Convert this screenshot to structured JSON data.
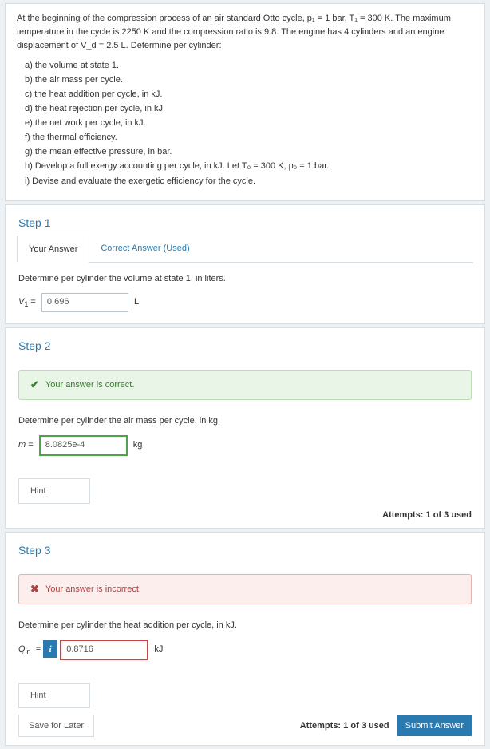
{
  "problem": {
    "stem": "At the beginning of the compression process of an air standard Otto cycle, p₁ = 1 bar, T₁ = 300 K. The maximum temperature in the cycle is 2250 K and the compression ratio is 9.8. The engine has 4 cylinders and an engine displacement of V_d = 2.5 L.  Determine per cylinder:",
    "parts": [
      "a)   the volume at state 1.",
      "b)   the air mass per cycle.",
      "c)   the heat addition per cycle, in kJ.",
      "d)   the heat rejection per cycle, in kJ.",
      "e)   the net work per cycle, in kJ.",
      "f)   the thermal efficiency.",
      "g)   the mean effective pressure, in bar.",
      "h)   Develop a full exergy accounting per cycle, in kJ. Let T₀ = 300 K, p₀ = 1 bar.",
      "i)   Devise and evaluate the exergetic efficiency for the cycle."
    ]
  },
  "tabs": {
    "your": "Your Answer",
    "correct": "Correct Answer (Used)"
  },
  "step1": {
    "title": "Step 1",
    "prompt": "Determine per cylinder the volume at state 1, in liters.",
    "var": "V₁ =",
    "value": "0.696",
    "unit": "L"
  },
  "step2": {
    "title": "Step 2",
    "banner": "Your answer is correct.",
    "prompt": "Determine per cylinder the air mass per cycle, in kg.",
    "var": "m =",
    "value": "8.0825e-4",
    "unit": "kg",
    "hint": "Hint",
    "attempts": "Attempts: 1 of 3 used"
  },
  "step3": {
    "title": "Step 3",
    "banner": "Your answer is incorrect.",
    "prompt": "Determine per cylinder the heat addition per cycle, in kJ.",
    "value": "0.8716",
    "unit": "kJ",
    "hint": "Hint",
    "save": "Save for Later",
    "attempts": "Attempts: 1 of 3 used",
    "submit": "Submit Answer"
  },
  "icons": {
    "check": "✔",
    "cross": "✖",
    "info": "i"
  }
}
